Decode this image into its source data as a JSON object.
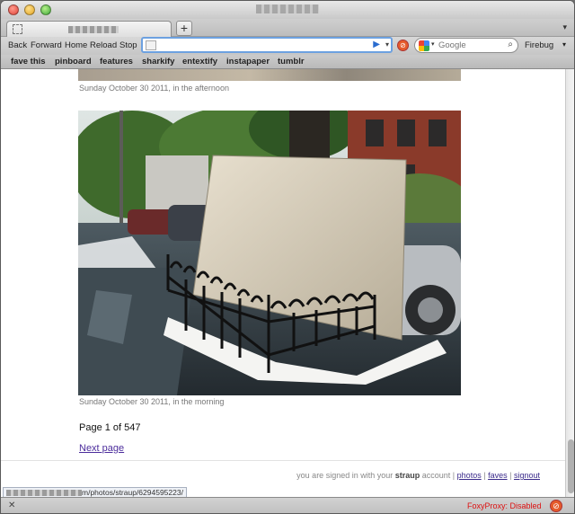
{
  "toolbar": {
    "back": "Back",
    "forward": "Forward",
    "home": "Home",
    "reload": "Reload",
    "stop": "Stop",
    "new_tab_symbol": "+",
    "tab_menu_symbol": "▾",
    "go_symbol": "▶",
    "dropdown_symbol": "▾"
  },
  "search": {
    "placeholder": "Google",
    "engine_dropdown": "▾",
    "magnifier": "🔍"
  },
  "firebug": {
    "label": "Firebug",
    "dropdown": "▾"
  },
  "bookmarks": [
    "fave this",
    "pinboard",
    "features",
    "sharkify",
    "entextify",
    "instapaper",
    "tumblr"
  ],
  "page": {
    "caption_top": "Sunday October 30 2011, in the afternoon",
    "caption_bottom": "Sunday October 30 2011, in the morning",
    "pager": "Page 1 of 547",
    "next_page": "Next page",
    "footer": {
      "prefix": "you are signed in with your",
      "user": "straup",
      "suffix": "account |",
      "links": [
        "photos",
        "faves",
        "signout"
      ],
      "sep": "|"
    },
    "status_url": "m/photos/straup/6294595223/"
  },
  "statusbar": {
    "close_symbol": "✕",
    "foxyproxy": "FoxyProxy: Disabled"
  },
  "colors": {
    "link": "#4c2d9c",
    "foxyproxy": "#dd1111",
    "urlbar_focus": "#6da1e0"
  }
}
